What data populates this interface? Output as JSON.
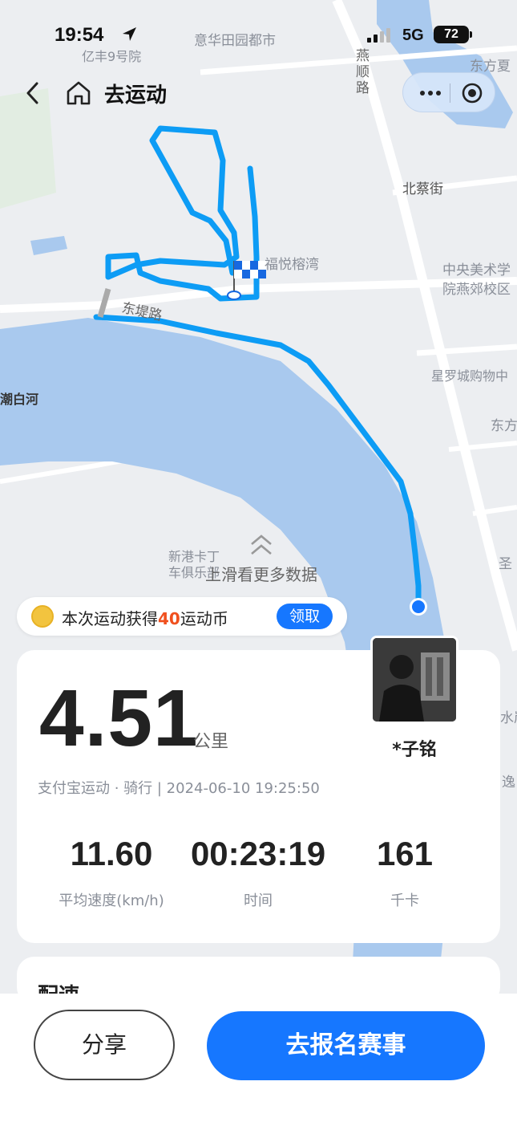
{
  "status_bar": {
    "time": "19:54",
    "network": "5G",
    "battery": "72",
    "location_sub": "亿丰9号院"
  },
  "nav": {
    "title": "去运动"
  },
  "map": {
    "labels": {
      "yihua": "意华田园都市",
      "dongfang_top": "东方夏",
      "yanshun": "燕顺路",
      "beicai": "北蔡街",
      "fuyue": "福悦榕湾",
      "zhongyang": "中央美术学",
      "yanjiao": "院燕郊校区",
      "dongdi": "东堤路",
      "xingluo": "星罗城购物中",
      "dongfang_mid": "东方",
      "chaobai": "潮白河",
      "xingang": "新港卡丁",
      "xingang2": "车俱乐部",
      "sheng": "圣",
      "shui": "水岸",
      "yi": "逸"
    }
  },
  "more_data": "上滑看更多数据",
  "coin_banner": {
    "prefix": "本次运动获得",
    "amount": "40",
    "suffix": "运动币",
    "claim": "领取"
  },
  "stats": {
    "distance": "4.51",
    "distance_unit": "公里",
    "user_name": "*子铭",
    "meta": "支付宝运动 · 骑行 | 2024-06-10 19:25:50",
    "avg_speed": "11.60",
    "avg_speed_label": "平均速度(km/h)",
    "duration": "00:23:19",
    "duration_label": "时间",
    "calories": "161",
    "calories_label": "千卡"
  },
  "pace_card": {
    "title": "配速"
  },
  "bottom": {
    "share": "分享",
    "signup": "去报名赛事"
  },
  "colors": {
    "route": "#0d9cf5",
    "primary": "#1677ff",
    "water": "#a9c9ee",
    "map_bg": "#eceef1"
  }
}
